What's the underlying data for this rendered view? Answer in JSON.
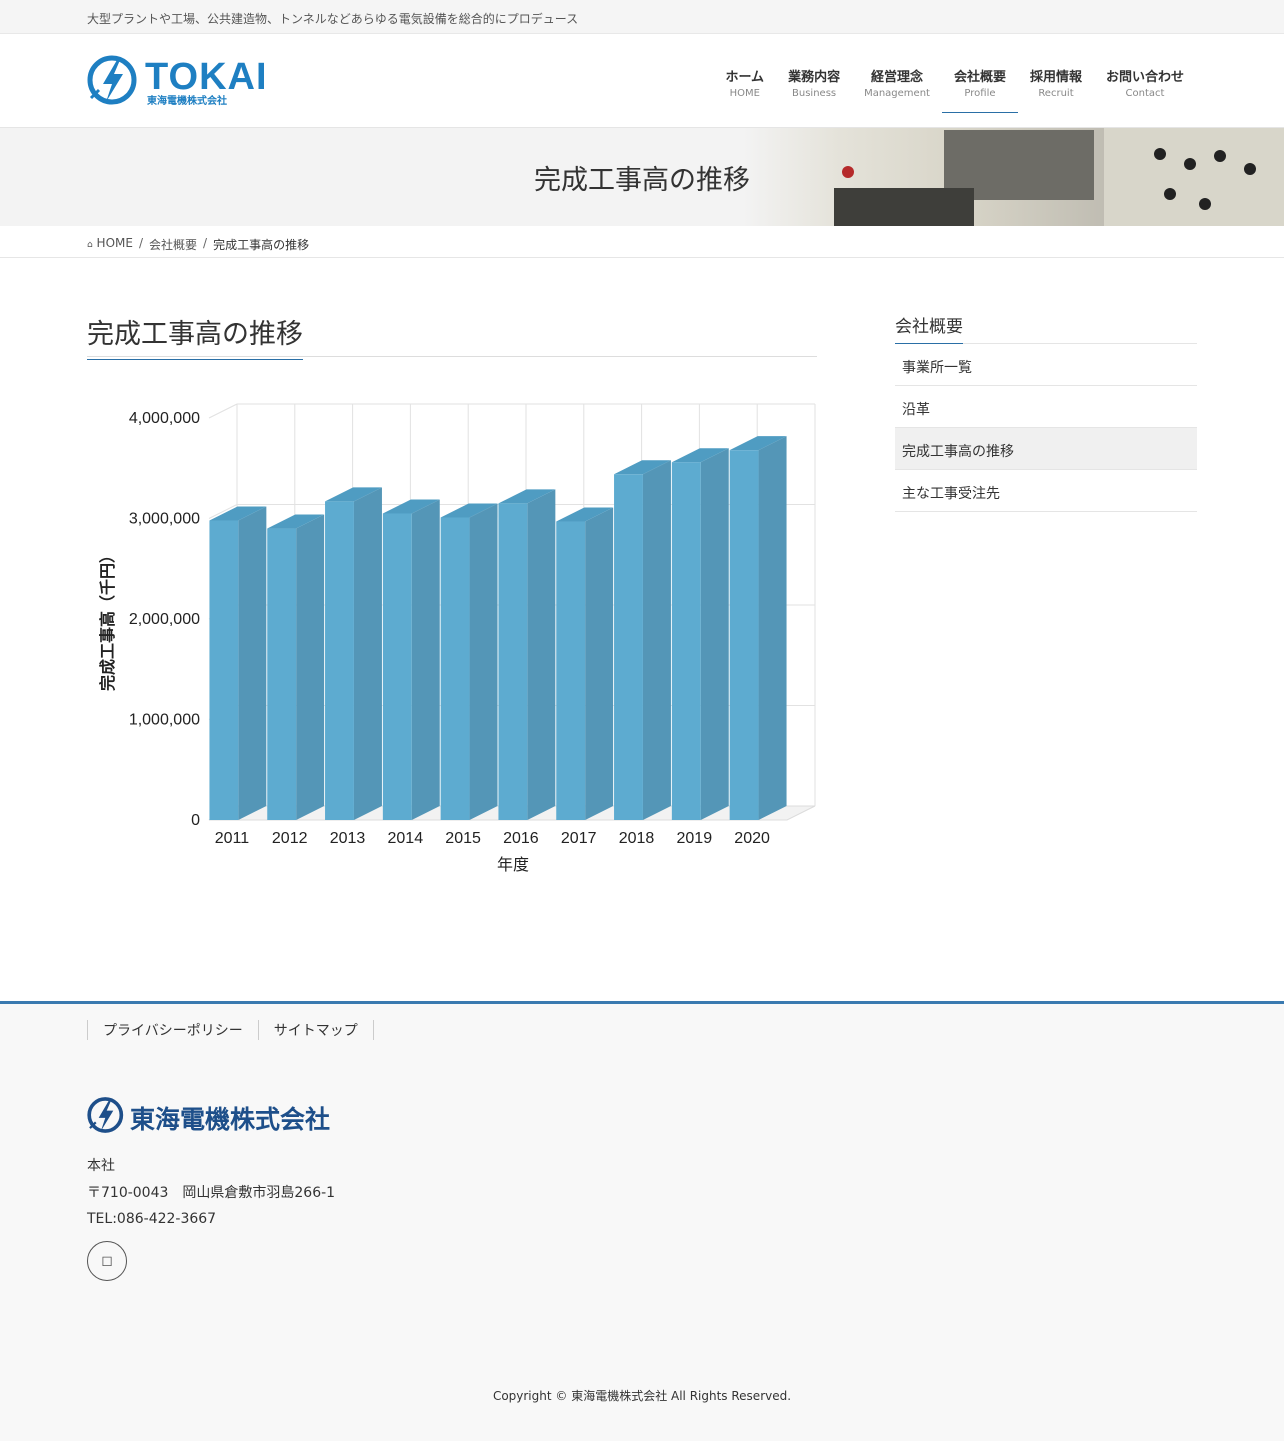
{
  "topbar": {
    "tagline": "大型プラントや工場、公共建造物、トンネルなどあらゆる電気設備を総合的にプロデュース"
  },
  "logo": {
    "text": "TOKAI",
    "subtitle": "東海電機株式会社"
  },
  "nav": [
    {
      "jp": "ホーム",
      "en": "HOME"
    },
    {
      "jp": "業務内容",
      "en": "Business"
    },
    {
      "jp": "経営理念",
      "en": "Management"
    },
    {
      "jp": "会社概要",
      "en": "Profile"
    },
    {
      "jp": "採用情報",
      "en": "Recruit"
    },
    {
      "jp": "お問い合わせ",
      "en": "Contact"
    }
  ],
  "page_header": {
    "title": "完成工事高の推移"
  },
  "breadcrumb": {
    "home": "HOME",
    "parent": "会社概要",
    "current": "完成工事高の推移"
  },
  "main": {
    "title": "完成工事高の推移"
  },
  "chart_data": {
    "type": "bar",
    "categories": [
      "2011",
      "2012",
      "2013",
      "2014",
      "2015",
      "2016",
      "2017",
      "2018",
      "2019",
      "2020"
    ],
    "values": [
      2980000,
      2900000,
      3170000,
      3050000,
      3010000,
      3150000,
      2970000,
      3440000,
      3560000,
      3680000
    ],
    "ylim": [
      0,
      4000000
    ],
    "yticks": [
      "4,000,000",
      "3,000,000",
      "2,000,000",
      "1,000,000",
      "0"
    ],
    "xlabel": "年度",
    "ylabel": "完成工事高（千円）",
    "grid": true,
    "bar_color": "#5dabd0"
  },
  "sidebar": {
    "title": "会社概要",
    "items": [
      "事業所一覧",
      "沿革",
      "完成工事高の推移",
      "主な工事受注先"
    ]
  },
  "footer": {
    "links": [
      "プライバシーポリシー",
      "サイトマップ"
    ],
    "company": "東海電機株式会社",
    "address_label": "本社",
    "address": "〒710-0043　岡山県倉敷市羽島266-1",
    "tel": "TEL:086-422-3667",
    "copyright": "Copyright © 東海電機株式会社 All Rights Reserved."
  },
  "colors": {
    "accent": "#2a6fa6",
    "brand": "#1e7fc2"
  }
}
